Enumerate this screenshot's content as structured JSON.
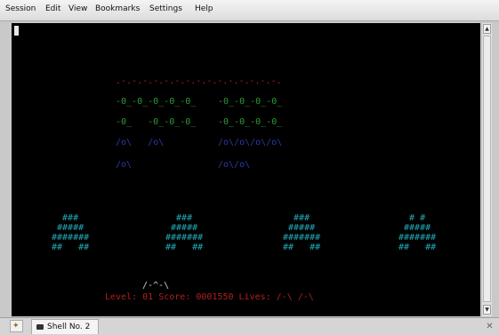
{
  "menu": {
    "items": [
      "Session",
      "Edit",
      "View",
      "Bookmarks",
      "Settings",
      "Help"
    ]
  },
  "game": {
    "mothership": ".-.-.-.-.-.-.-.-.-.-.-.-.-.-.-.",
    "invader_rows": [
      {
        "left": "-0_-0_-0_-0_-0_",
        "right": "-0_-0_-0_-0_",
        "color": "#2f9a3a"
      },
      {
        "left": "-0_   -0_-0_-0_",
        "right": "-0_-0_-0_-0_",
        "color": "#2f9a3a"
      },
      {
        "left": "/o\\   /o\\",
        "right": "/o\\/o\\/o\\/o\\",
        "color": "#2a3aa8"
      },
      {
        "left": "/o\\",
        "right": "/o\\/o\\",
        "color": "#2a3aa8"
      }
    ],
    "shields": [
      [
        "  ###  ",
        " ##### ",
        "#######",
        "##   ##"
      ],
      [
        "  ###  ",
        " ##### ",
        "#######",
        "##   ##"
      ],
      [
        "  ###  ",
        " ##### ",
        "#######",
        "##   ##"
      ],
      [
        "  # #  ",
        " ##### ",
        "#######",
        "##   ##"
      ]
    ],
    "player": "/-^-\\",
    "status": "Level: 01 Score: 0001550 Lives: /-\\ /-\\",
    "colors": {
      "mothership": "#b02020",
      "shield": "#21a7b5",
      "player": "#cfcfcf",
      "status": "#b02020"
    }
  },
  "tabs": [
    {
      "label": "Shell No. 2"
    }
  ],
  "icons": {
    "new_tab": "new-session-icon",
    "tab": "terminal-icon",
    "close": "close-icon"
  }
}
